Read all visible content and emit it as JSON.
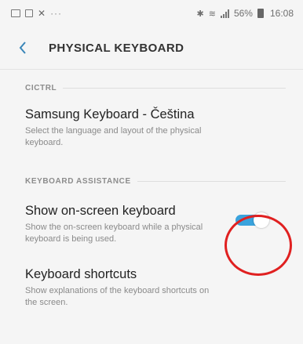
{
  "status_bar": {
    "dots": "···",
    "battery_percent": "56%",
    "time": "16:08"
  },
  "header": {
    "title": "PHYSICAL KEYBOARD"
  },
  "sections": [
    {
      "label": "CICTRL",
      "items": [
        {
          "title": "Samsung Keyboard - Čeština",
          "description": "Select the language and layout of the physical keyboard."
        }
      ]
    },
    {
      "label": "KEYBOARD ASSISTANCE",
      "items": [
        {
          "title": "Show on-screen keyboard",
          "description": "Show the on-screen keyboard while a physical keyboard is being used.",
          "toggle_on": true
        },
        {
          "title": "Keyboard shortcuts",
          "description": "Show explanations of the keyboard shortcuts on the screen."
        }
      ]
    }
  ],
  "colors": {
    "toggle_accent": "#3aa3dd",
    "annotation": "#e02020"
  }
}
